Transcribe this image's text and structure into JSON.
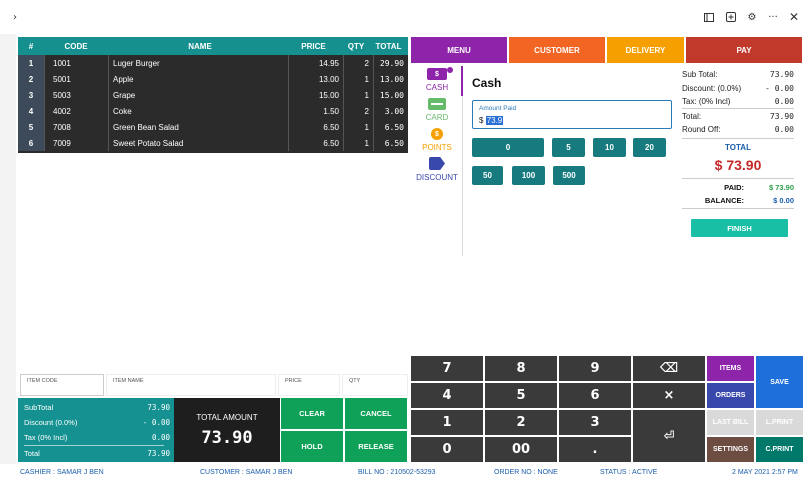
{
  "titlebar": {
    "icons": [
      "chevron-right-icon",
      "tablet-icon",
      "plus-box-icon",
      "gear-icon",
      "more-icon",
      "close-icon"
    ]
  },
  "cart": {
    "headers": {
      "num": "#",
      "code": "CODE",
      "name": "NAME",
      "price": "PRICE",
      "qty": "QTY",
      "total": "TOTAL"
    },
    "rows": [
      {
        "num": "1",
        "code": "1001",
        "name": "Luger Burger",
        "price": "14.95",
        "qty": "2",
        "total": "29.90"
      },
      {
        "num": "2",
        "code": "5001",
        "name": "Apple",
        "price": "13.00",
        "qty": "1",
        "total": "13.00"
      },
      {
        "num": "3",
        "code": "5003",
        "name": "Grape",
        "price": "15.00",
        "qty": "1",
        "total": "15.00"
      },
      {
        "num": "4",
        "code": "4002",
        "name": "Coke",
        "price": "1.50",
        "qty": "2",
        "total": "3.00"
      },
      {
        "num": "5",
        "code": "7008",
        "name": "Green Bean Salad",
        "price": "6.50",
        "qty": "1",
        "total": "6.50"
      },
      {
        "num": "6",
        "code": "7009",
        "name": "Sweet Potato Salad",
        "price": "6.50",
        "qty": "1",
        "total": "6.50"
      }
    ]
  },
  "tabs": {
    "menu": "MENU",
    "customer": "CUSTOMER",
    "delivery": "DELIVERY",
    "pay": "PAY"
  },
  "payment_methods": {
    "cash": "CASH",
    "card": "CARD",
    "points": "POINTS",
    "discount": "DISCOUNT"
  },
  "cash_panel": {
    "title": "Cash",
    "amount_label": "Amount Paid",
    "currency": "$",
    "amount_value": "73.9",
    "quick_amounts_row1": [
      "0",
      "5",
      "10",
      "20"
    ],
    "quick_amounts_row2": [
      "50",
      "100",
      "500"
    ]
  },
  "summary": {
    "sub_total_label": "Sub Total:",
    "sub_total": "73.90",
    "discount_label": "Discount: (0.0%)",
    "discount": "- 0.00",
    "tax_label": "Tax: (0% Incl)",
    "tax": "0.00",
    "total_label": "Total:",
    "total": "73.90",
    "round_off_label": "Round Off:",
    "round_off": "0.00",
    "grand_total_label": "TOTAL",
    "grand_total": "$ 73.90",
    "paid_label": "PAID:",
    "paid": "$ 73.90",
    "balance_label": "BALANCE:",
    "balance": "$ 0.00",
    "finish_label": "FINISH"
  },
  "item_inputs": {
    "item_code": "ITEM CODE",
    "item_name": "ITEM NAME",
    "price": "PRICE",
    "qty": "QTY"
  },
  "subtotals": {
    "subtotal_label": "SubTotal",
    "subtotal": "73.90",
    "discount_label": "Discount (0.0%)",
    "discount": "- 0.00",
    "tax_label": "Tax (0% Incl)",
    "tax": "0.00",
    "total_label": "Total",
    "total": "73.90"
  },
  "total_amount": {
    "label": "TOTAL AMOUNT",
    "value": "73.90"
  },
  "actions": {
    "clear": "CLEAR",
    "cancel": "CANCEL",
    "hold": "HOLD",
    "release": "RELEASE"
  },
  "keypad": {
    "k7": "7",
    "k8": "8",
    "k9": "9",
    "k4": "4",
    "k5": "5",
    "k6": "6",
    "k1": "1",
    "k2": "2",
    "k3": "3",
    "k0": "0",
    "k00": "00",
    "kdot": ".",
    "backspace": "⌫",
    "multiply": "×",
    "enter": "⏎"
  },
  "function_keys": {
    "items": "ITEMS",
    "orders": "ORDERS",
    "save": "SAVE",
    "last_bill": "LAST BILL",
    "lprint": "L.PRINT",
    "settings": "SETTINGS",
    "cprint": "C.PRINT"
  },
  "status": {
    "cashier": "CASHIER : SAMAR J BEN",
    "customer": "CUSTOMER : SAMAR J BEN",
    "bill_no": "BILL NO : 210502-53293",
    "order_no": "ORDER NO : NONE",
    "status": "STATUS : ACTIVE",
    "datetime": "2 MAY 2021 2:57 PM"
  },
  "colors": {
    "teal": "#16908f",
    "purple": "#8e24aa",
    "orange": "#f26522",
    "amber": "#f5a000",
    "red": "#c0392b",
    "green": "#0fa158"
  }
}
